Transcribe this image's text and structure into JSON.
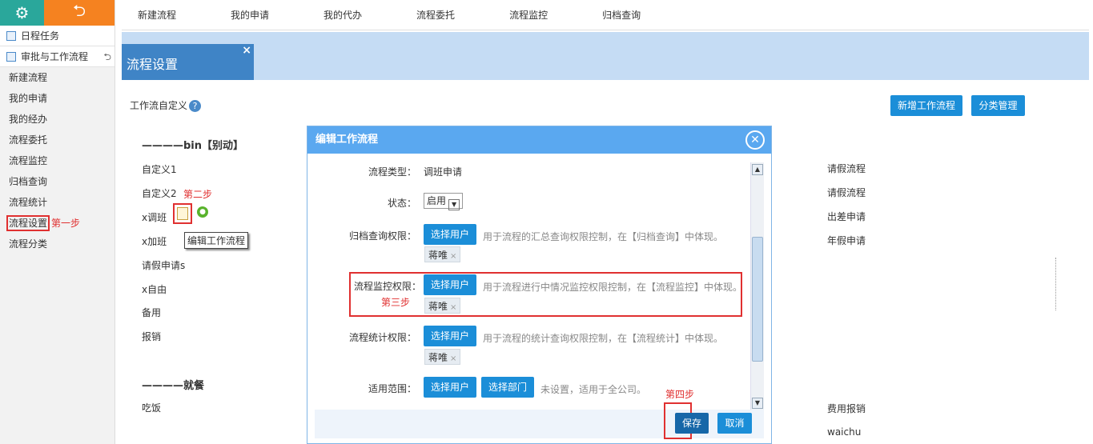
{
  "sidebar": {
    "rows": [
      {
        "label": "日程任务"
      },
      {
        "label": "审批与工作流程"
      }
    ],
    "items": [
      "新建流程",
      "我的申请",
      "我的经办",
      "流程委托",
      "流程监控",
      "归档查询",
      "流程统计",
      "流程设置",
      "流程分类"
    ],
    "step1": "第一步"
  },
  "topnav": [
    "新建流程",
    "我的申请",
    "我的代办",
    "流程委托",
    "流程监控",
    "归档查询"
  ],
  "page_tab": {
    "title": "流程设置",
    "close": "×"
  },
  "main": {
    "workflow_def_label": "工作流自定义",
    "help": "?",
    "add_workflow_btn": "新增工作流程",
    "category_mgmt_btn": "分类管理",
    "group1": "————bin【别动】",
    "group1_items": [
      "自定义1",
      "自定义2",
      "x调班",
      "x加班",
      "请假申请s",
      "x自由",
      "备用",
      "报销"
    ],
    "step2": "第二步",
    "tooltip": "编辑工作流程",
    "group2": "————就餐",
    "group2_items": [
      "吃饭"
    ],
    "right_items": [
      "请假流程",
      "请假流程",
      "出差申请",
      "年假申请"
    ],
    "right_items_bottom": [
      "费用报销",
      "waichu"
    ]
  },
  "modal": {
    "title": "编辑工作流程",
    "type_label": "流程类型：",
    "type_value": "调班申请",
    "status_label": "状态：",
    "status_value": "启用",
    "archive_label": "归档查询权限：",
    "archive_btn": "选择用户",
    "archive_hint": "用于流程的汇总查询权限控制，在【归档查询】中体现。",
    "archive_tag": "蒋唯",
    "monitor_label": "流程监控权限：",
    "monitor_btn": "选择用户",
    "monitor_hint": "用于流程进行中情况监控权限控制，在【流程监控】中体现。",
    "monitor_tag": "蒋唯",
    "step3": "第三步",
    "stats_label": "流程统计权限：",
    "stats_btn": "选择用户",
    "stats_hint": "用于流程的统计查询权限控制，在【流程统计】中体现。",
    "stats_tag": "蒋唯",
    "scope_label": "适用范围：",
    "scope_user_btn": "选择用户",
    "scope_dept_btn": "选择部门",
    "scope_hint": "未设置，适用于全公司。",
    "step4": "第四步",
    "save_btn": "保存",
    "cancel_btn": "取消",
    "tag_remove": "×"
  },
  "colors": {
    "accent": "#1b8ed8",
    "step_red": "#e03030",
    "header_blue": "#5aa8f0"
  }
}
